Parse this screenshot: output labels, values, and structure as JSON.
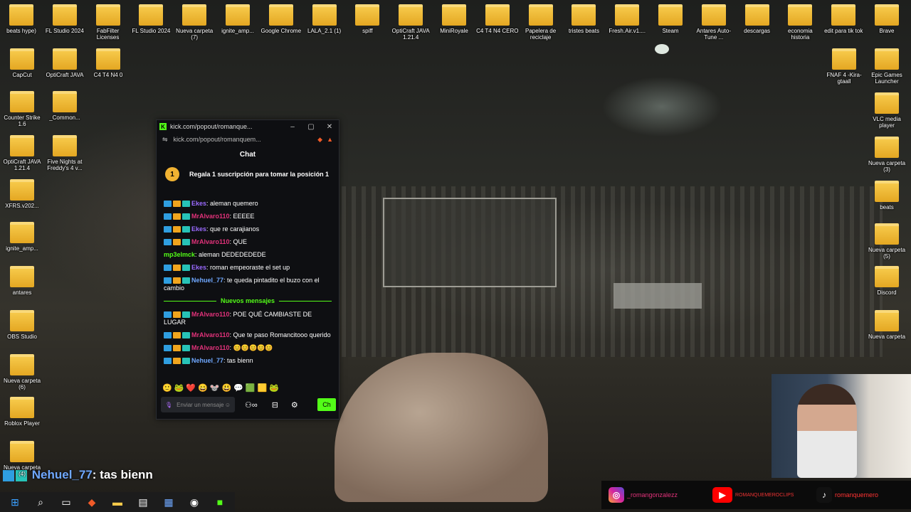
{
  "desktop_icons": {
    "row1": [
      "beats hype)",
      "FL Studio 2024",
      "FabFilter Licenses",
      "FL Studio 2024",
      "Nueva carpeta (7)",
      "ignite_amp...",
      "Google Chrome",
      "LALA_2.1 (1)",
      "spiff",
      "OptiCraft JAVA 1.21.4",
      "MiniRoyale",
      "C4 T4 N4 CERO",
      "Papelera de reciclaje",
      "tristes beats",
      "Fresh.Air.v1....",
      "Steam",
      "Antares Auto-Tune ...",
      "descargas",
      "economia historia",
      "edit para tik tok",
      "Brave"
    ],
    "left_col": [
      "CapCut",
      "OptiCraft JAVA",
      "C4 T4 N4 0",
      "Counter Strike 1.6",
      "_Common...",
      "OptiCraft JAVA 1.21.4",
      "Five Nights at Freddy's 4 v...",
      "XFRS.v202...",
      "ignite_amp...",
      "antares",
      "OBS Studio",
      "Nueva carpeta (6)",
      "Roblox Player",
      "Nueva carpeta (4)"
    ],
    "right_col": [
      "FNAF 4 -Kira-gtaall",
      "Epic Games Launcher",
      "VLC media player",
      "Nueva carpeta (3)",
      "beats",
      "Nueva carpeta (5)",
      "Discord",
      "Nueva carpeta"
    ]
  },
  "chat_window": {
    "title": "kick.com/popout/romanque...",
    "url": "kick.com/popout/romanquem...",
    "header": "Chat",
    "promo_rank": "1",
    "promo_text": "Regala 1 suscripción para tomar la posición 1",
    "messages": [
      {
        "user": "Ekes",
        "text": "aleman quemero"
      },
      {
        "user": "MrAlvaro110",
        "text": "EEEEE"
      },
      {
        "user": "Ekes",
        "text": "que re carajianos"
      },
      {
        "user": "MrAlvaro110",
        "text": "QUE"
      },
      {
        "user": "mp3elmck",
        "text": "aleman DEDEDEDEDE"
      },
      {
        "user": "Ekes",
        "text": "roman empeoraste el set up"
      },
      {
        "user": "Nehuel_77",
        "text": "te queda pintadito el buzo con el cambio"
      }
    ],
    "separator": "Nuevos mensajes",
    "new_messages": [
      {
        "user": "MrAlvaro110",
        "text": "POE QUÉ CAMBIASTE DE LUGAR"
      },
      {
        "user": "MrAlvaro110",
        "text": "Que te paso Romancitooo querido"
      },
      {
        "user": "MrAlvaro110",
        "text": "😊😊😊😊😊"
      },
      {
        "user": "Nehuel_77",
        "text": "tas bienn"
      }
    ],
    "emotes": "🙂🐸❤️😄🐭😃💬🟩🟨🐸",
    "input_placeholder": "Enviar un mensaje",
    "send_label": "Ch"
  },
  "overlay": {
    "user": "Nehuel_77",
    "text": ": tas bienn"
  },
  "social": {
    "instagram": "_romangonzalezz",
    "youtube": "ROMANQUEMEROCLIPS",
    "tiktok": "romanquemero"
  },
  "colors": {
    "kick_green": "#53fc18",
    "folder": "#f2bd3a"
  }
}
